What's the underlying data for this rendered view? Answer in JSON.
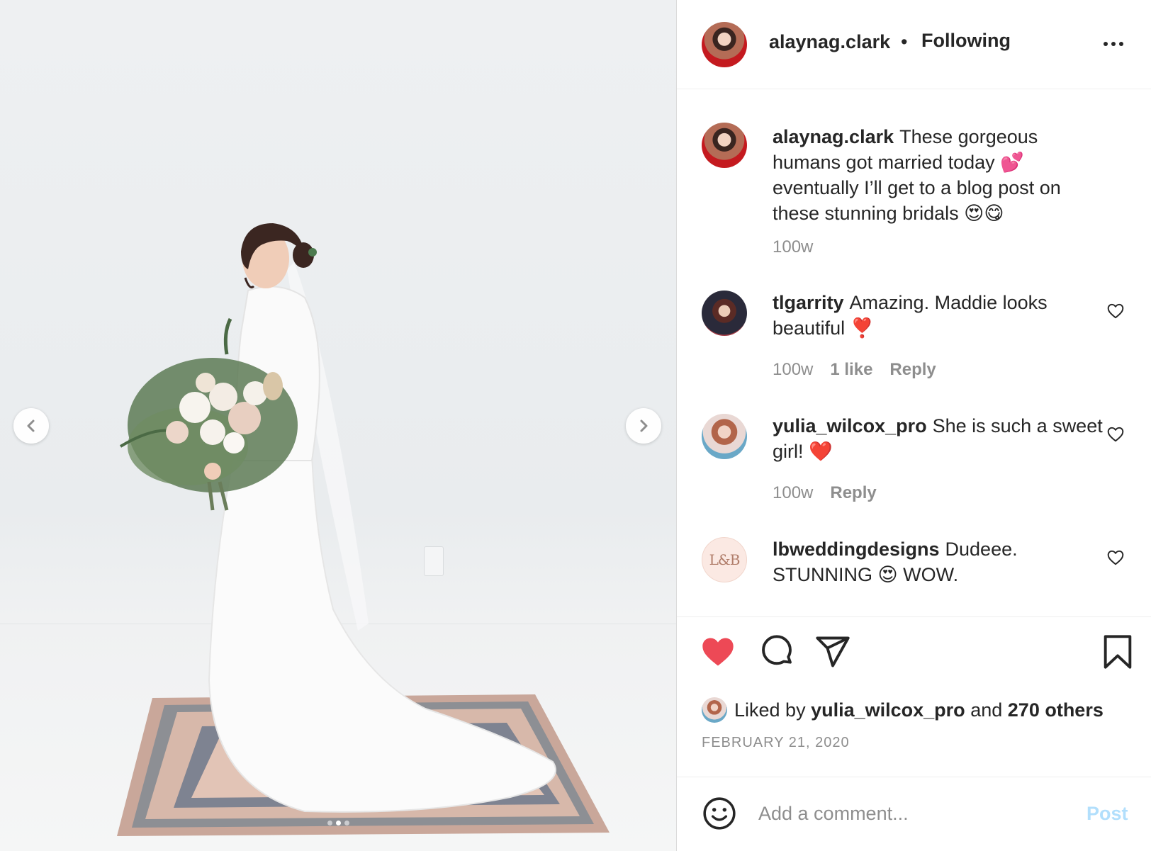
{
  "post": {
    "username": "alaynag.clark",
    "separator": "•",
    "follow_state": "Following",
    "more_label": "More options"
  },
  "caption": {
    "username": "alaynag.clark",
    "text": "These gorgeous humans got married today 💕 eventually I’ll get to a blog post on these stunning bridals 😍😋",
    "time": "100w"
  },
  "comments": [
    {
      "username": "tlgarrity",
      "text": "Amazing. Maddie looks beautiful ❣️",
      "time": "100w",
      "likes": "1 like",
      "reply": "Reply"
    },
    {
      "username": "yulia_wilcox_pro",
      "text": "She is such a sweet girl! ❤️",
      "time": "100w",
      "reply": "Reply"
    },
    {
      "username": "lbweddingdesigns",
      "text": "Dudeee. STUNNING 😍 WOW.",
      "avatar_text": "L&B"
    }
  ],
  "likes": {
    "prefix": "Liked by",
    "user": "yulia_wilcox_pro",
    "conjunction": "and",
    "others": "270 others"
  },
  "date": "FEBRUARY 21, 2020",
  "composer": {
    "placeholder": "Add a comment...",
    "post_label": "Post"
  },
  "carousel": {
    "slide_count": 3,
    "active_slide": 1
  },
  "colors": {
    "like_red": "#ed4956",
    "post_disabled_blue": "#b2dffc",
    "text_primary": "#262626",
    "text_secondary": "#8e8e8e"
  }
}
